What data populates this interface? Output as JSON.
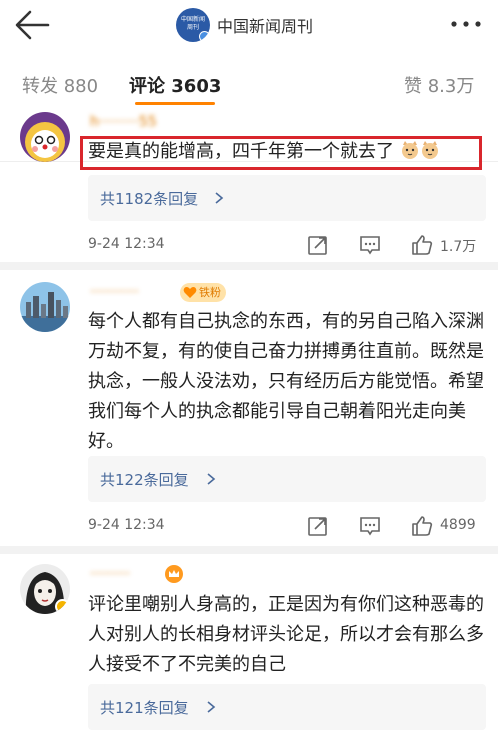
{
  "header": {
    "account_name": "中国新闻周刊",
    "avatar_text": "中国新闻周刊"
  },
  "tabs": [
    {
      "label": "转发 880",
      "active": false
    },
    {
      "label": "评论 3603",
      "active": true
    },
    {
      "label": "赞 8.3万",
      "active": false
    }
  ],
  "comments": [
    {
      "username": "h·········55",
      "text": "要是真的能增高，四千年第一个就去了",
      "replies": "共1182条回复",
      "time": "9-24 12:34",
      "likes": "1.7万"
    },
    {
      "username": "···········",
      "badge": "铁粉",
      "text": "每个人都有自己执念的东西，有的另自己陷入深渊万劫不复，有的使自己奋力拼搏勇往直前。既然是执念，一般人没法劝，只有经历后方能觉悟。希望我们每个人的执念都能引导自己朝着阳光走向美好。",
      "replies": "共122条回复",
      "time": "9-24 12:34",
      "likes": "4899"
    },
    {
      "username": "·········",
      "text": "评论里嘲别人身高的，正是因为有你们这种恶毒的人对别人的长相身材评头论足，所以才会有那么多人接受不了不完美的自己",
      "replies": "共121条回复"
    }
  ],
  "colors": {
    "accent": "#ff8200",
    "link": "#4a6a9b",
    "highlight": "#d9262c"
  }
}
